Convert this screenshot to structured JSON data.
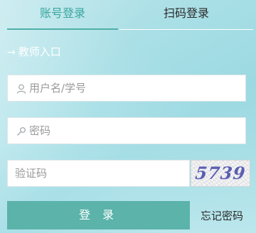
{
  "tabs": {
    "account_login": "账号登录",
    "scan_login": "扫码登录"
  },
  "section": {
    "arrow": "→",
    "label": "教师入口"
  },
  "form": {
    "username_placeholder": "用户名/学号",
    "password_placeholder": "密码",
    "captcha_placeholder": "验证码",
    "captcha_code": "5739",
    "login_label": "登 录",
    "forgot_password": "忘记密码"
  },
  "icons": {
    "user": "user-icon",
    "key": "key-icon"
  },
  "colors": {
    "accent": "#4fb0a8",
    "button": "#5bb3aa",
    "active_tab_text": "#3aa7a0",
    "captcha_text": "#5a5fb0"
  }
}
